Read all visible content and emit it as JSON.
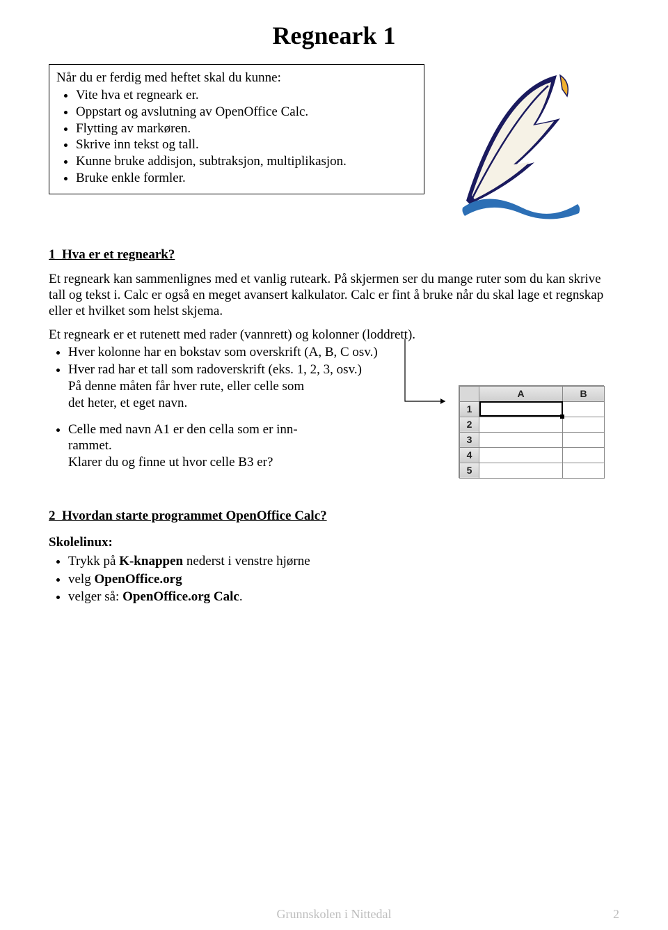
{
  "title": "Regneark 1",
  "objectives": {
    "heading": "Når du er ferdig med heftet skal du kunne:",
    "items": [
      "Vite hva et regneark er.",
      "Oppstart og avslutning av OpenOffice Calc.",
      "Flytting av markøren.",
      "Skrive inn tekst og tall.",
      "Kunne bruke addisjon, subtraksjon, multiplikasjon.",
      "Bruke enkle formler."
    ]
  },
  "section1": {
    "number": "1",
    "heading": "Hva er et regneark?",
    "para1": "Et regneark kan sammenlignes med et vanlig ruteark. På skjermen ser du mange ruter som du kan skrive tall og tekst i. Calc er også en meget avansert kalkulator. Calc er fint å bruke når du skal lage et regnskap eller et hvilket som helst skjema.",
    "para2": "Et regneark er et rutenett med rader (vannrett) og kolonner (loddrett).",
    "bulletsA": [
      "Hver kolonne har en bokstav som overskrift (A, B, C osv.)",
      "Hver rad har et tall som radoverskrift (eks. 1, 2, 3, osv.)"
    ],
    "afterA": [
      "På denne måten får hver rute, eller celle som",
      "det heter, et eget navn."
    ],
    "bulletsB": [
      "Celle med navn A1 er den cella som er inn-",
      "rammet."
    ],
    "afterB": "Klarer du og finne ut hvor celle B3 er?"
  },
  "grid": {
    "cols": [
      "A",
      "B"
    ],
    "rows": [
      "1",
      "2",
      "3",
      "4",
      "5"
    ]
  },
  "section2": {
    "number": "2",
    "heading": "Hvordan starte programmet OpenOffice Calc?",
    "label": "Skolelinux:",
    "steps": [
      {
        "pre": "Trykk på ",
        "bold": "K-knappen",
        "post": " nederst i venstre hjørne"
      },
      {
        "pre": "velg ",
        "bold": "OpenOffice.org",
        "post": ""
      },
      {
        "pre": "velger så: ",
        "bold": "OpenOffice.org Calc",
        "post": "."
      }
    ]
  },
  "footer": {
    "center": "Grunnskolen i Nittedal",
    "page": "2"
  }
}
